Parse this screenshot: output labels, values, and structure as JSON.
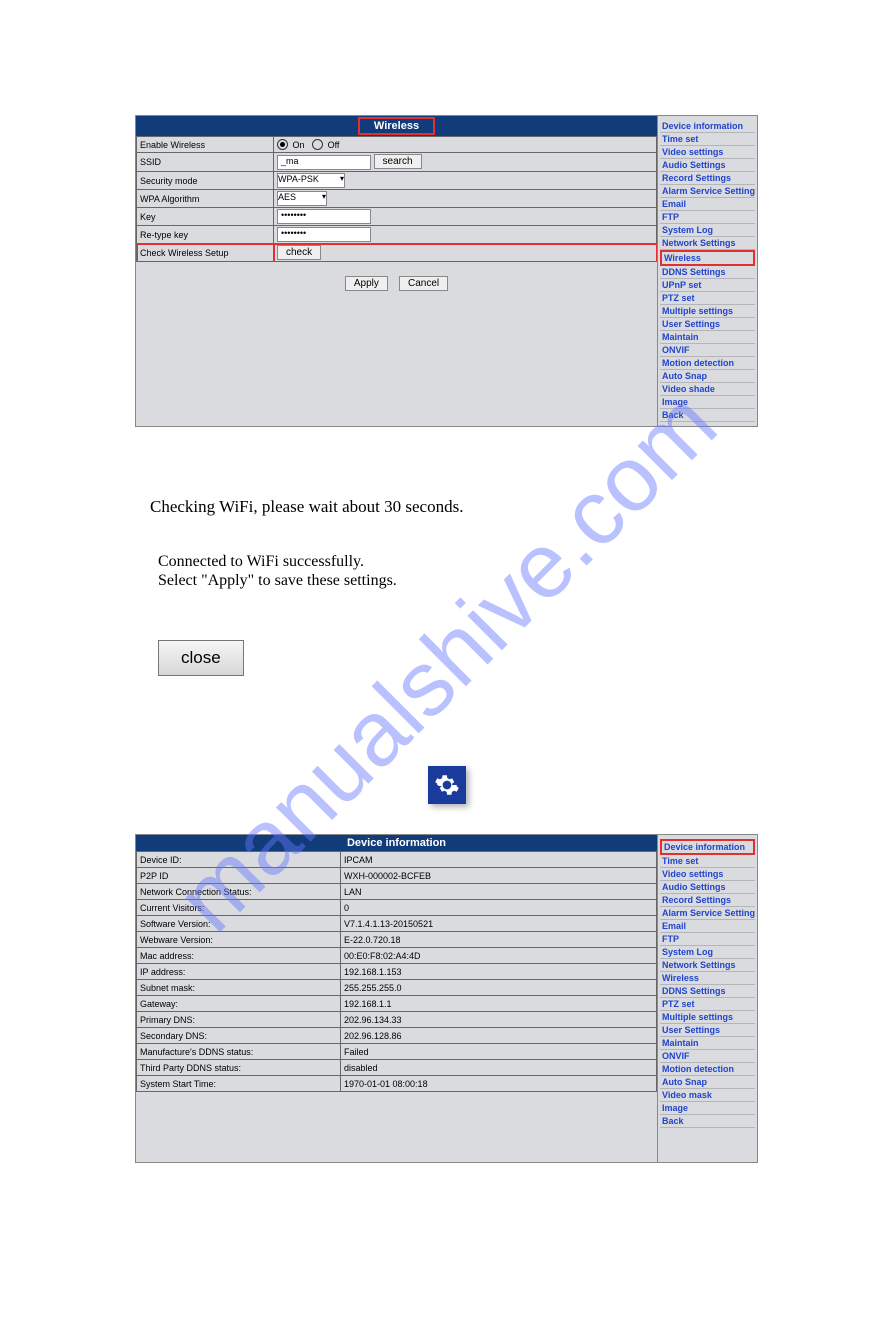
{
  "watermark": "manualshive.com",
  "panel1": {
    "title": "Wireless",
    "rows": {
      "enable_wireless": {
        "label": "Enable Wireless",
        "on": "On",
        "off": "Off"
      },
      "ssid": {
        "label": "SSID",
        "value": "_ma",
        "search": "search"
      },
      "security_mode": {
        "label": "Security mode",
        "value": "WPA-PSK"
      },
      "wpa_algorithm": {
        "label": "WPA Algorithm",
        "value": "AES"
      },
      "key": {
        "label": "Key",
        "value": "••••••••"
      },
      "retype_key": {
        "label": "Re-type key",
        "value": "••••••••"
      },
      "check_setup": {
        "label": "Check Wireless Setup",
        "button": "check"
      }
    },
    "apply": "Apply",
    "cancel": "Cancel",
    "nav": [
      "Device information",
      "Time set",
      "Video settings",
      "Audio Settings",
      "Record Settings",
      "Alarm Service Settings",
      "Email",
      "FTP",
      "System Log",
      "Network Settings",
      "Wireless",
      "DDNS Settings",
      "UPnP set",
      "PTZ set",
      "Multiple settings",
      "User Settings",
      "Maintain",
      "ONVIF",
      "Motion detection",
      "Auto Snap",
      "Video shade",
      "Image",
      "Back"
    ],
    "nav_hl_index": 10
  },
  "mid": {
    "checking": "Checking WiFi, please wait about 30 seconds.",
    "connected": "Connected to WiFi successfully.",
    "select_apply": "Select \"Apply\" to save these settings.",
    "close": "close"
  },
  "panel2": {
    "title": "Device information",
    "rows": [
      {
        "label": "Device ID:",
        "value": "IPCAM"
      },
      {
        "label": "P2P ID",
        "value": "WXH-000002-BCFEB"
      },
      {
        "label": "Network Connection Status:",
        "value": "LAN"
      },
      {
        "label": "Current Visitors:",
        "value": "0"
      },
      {
        "label": "Software Version:",
        "value": "V7.1.4.1.13-20150521"
      },
      {
        "label": "Webware Version:",
        "value": "E-22.0.720.18"
      },
      {
        "label": "Mac address:",
        "value": "00:E0:F8:02:A4:4D"
      },
      {
        "label": "IP address:",
        "value": "192.168.1.153"
      },
      {
        "label": "Subnet mask:",
        "value": "255.255.255.0"
      },
      {
        "label": "Gateway:",
        "value": "192.168.1.1"
      },
      {
        "label": "Primary DNS:",
        "value": "202.96.134.33"
      },
      {
        "label": "Secondary DNS:",
        "value": "202.96.128.86"
      },
      {
        "label": "Manufacture's DDNS status:",
        "value": "Failed"
      },
      {
        "label": "Third Party DDNS status:",
        "value": "disabled"
      },
      {
        "label": "System Start Time:",
        "value": "1970-01-01 08:00:18"
      }
    ],
    "nav": [
      "Device information",
      "Time set",
      "Video settings",
      "Audio Settings",
      "Record Settings",
      "Alarm Service Settings",
      "Email",
      "FTP",
      "System Log",
      "Network Settings",
      "Wireless",
      "DDNS Settings",
      "PTZ set",
      "Multiple settings",
      "User Settings",
      "Maintain",
      "ONVIF",
      "Motion detection",
      "Auto Snap",
      "Video mask",
      "Image",
      "Back"
    ],
    "nav_hl_index": 0
  }
}
